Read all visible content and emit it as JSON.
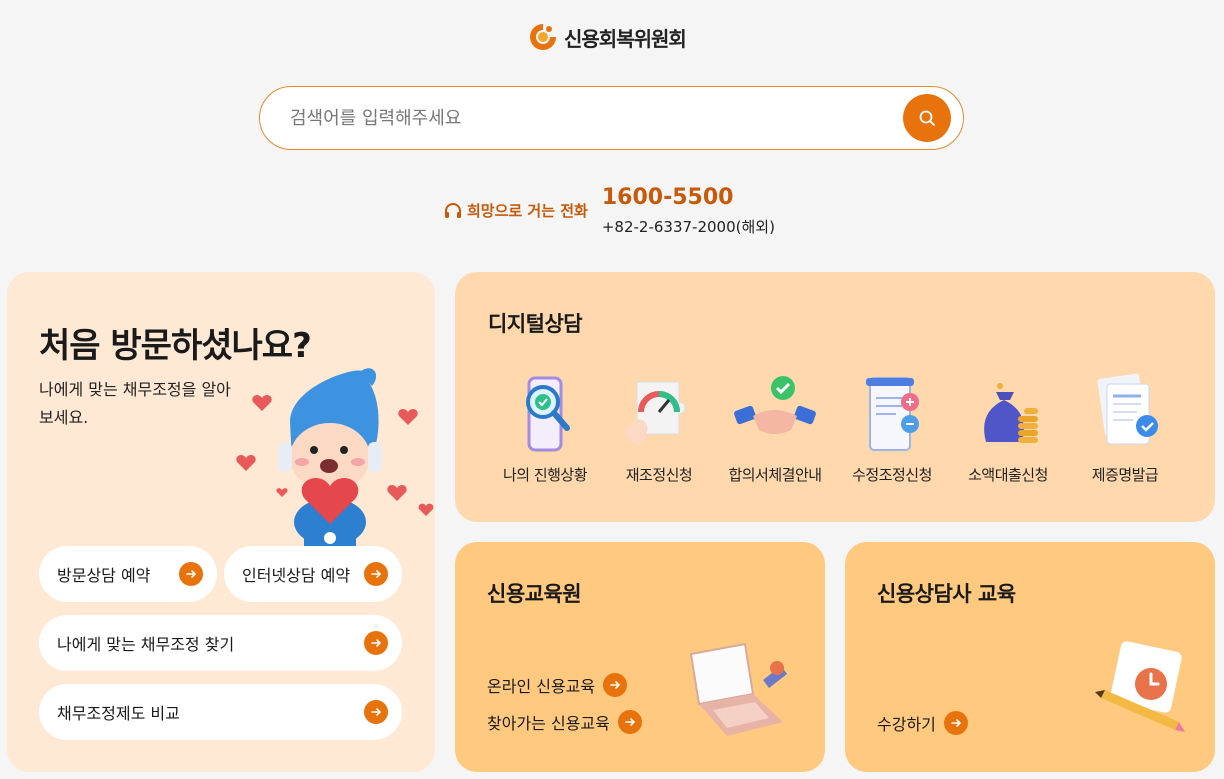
{
  "logo": {
    "text": "신용회복위원회",
    "mark_color": "#e8730c"
  },
  "search": {
    "placeholder": "검색어를 입력해주세요",
    "value": ""
  },
  "hotline": {
    "label": "희망으로 거는 전화",
    "main_number": "1600-5500",
    "intl_number": "+82-2-6337-2000(해외)"
  },
  "first_visit": {
    "title": "처음 방문하셨나요?",
    "desc": "나에게 맞는 채무조정을 알아보세요.",
    "buttons": [
      {
        "label": "방문상담 예약"
      },
      {
        "label": "인터넷상담 예약"
      },
      {
        "label": "나에게 맞는 채무조정 찾기"
      },
      {
        "label": "채무조정제도 비교"
      }
    ]
  },
  "digital": {
    "title": "디지털상담",
    "items": [
      {
        "label": "나의 진행상황",
        "icon": "magnifier-phone-icon"
      },
      {
        "label": "재조정신청",
        "icon": "gauge-puzzle-icon"
      },
      {
        "label": "합의서체결안내",
        "icon": "handshake-icon"
      },
      {
        "label": "수정조정신청",
        "icon": "document-plus-minus-icon"
      },
      {
        "label": "소액대출신청",
        "icon": "money-bag-icon"
      },
      {
        "label": "제증명발급",
        "icon": "certificate-check-icon"
      }
    ]
  },
  "edu_center": {
    "title": "신용교육원",
    "links": [
      {
        "label": "온라인 신용교육"
      },
      {
        "label": "찾아가는 신용교육"
      }
    ]
  },
  "counselor_edu": {
    "title": "신용상담사 교육",
    "links": [
      {
        "label": "수강하기"
      }
    ]
  },
  "colors": {
    "accent": "#e8730c",
    "accent_dark": "#c65a0a",
    "card_first_bg": "#ffe8d4",
    "card_digital_bg": "#ffd9ad",
    "card_edu_bg": "#ffc97f",
    "page_bg": "#f5f5f5"
  }
}
